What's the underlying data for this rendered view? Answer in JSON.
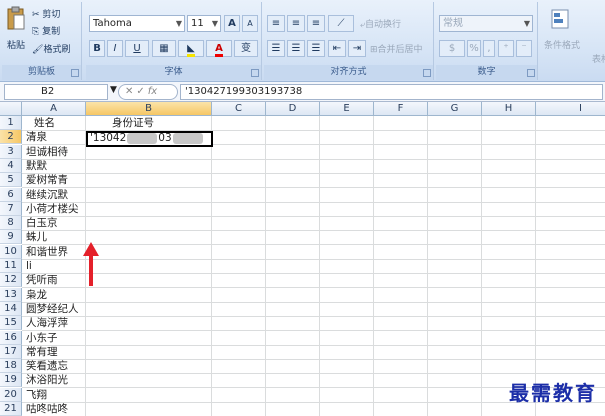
{
  "ribbon": {
    "clipboard": {
      "paste": "粘贴",
      "cut": "剪切",
      "copy": "复制",
      "format_painter": "格式刷",
      "label": "剪贴板"
    },
    "font": {
      "font_name": "Tahoma",
      "font_size": "11",
      "grow": "A",
      "shrink": "A",
      "bold": "B",
      "italic": "I",
      "underline": "U",
      "font_color": "A",
      "phonetic": "变",
      "label": "字体"
    },
    "alignment": {
      "wrap_text": "自动换行",
      "merge_center": "合并后居中",
      "label": "对齐方式"
    },
    "number": {
      "format": "常规",
      "percent": "%",
      "comma": ",",
      "label": "数字"
    },
    "styles": {
      "conditional": "条件格式",
      "table": "表格"
    }
  },
  "formula_bar": {
    "name_box": "B2",
    "fx": "fx",
    "content": "'130427199303193738"
  },
  "columns": [
    "A",
    "B",
    "C",
    "D",
    "E",
    "F",
    "G",
    "H",
    "I"
  ],
  "rows": [
    "1",
    "2",
    "3",
    "4",
    "5",
    "6",
    "7",
    "8",
    "9",
    "10",
    "11",
    "12",
    "13",
    "14",
    "15",
    "16",
    "17",
    "18",
    "19",
    "20",
    "21"
  ],
  "selected_cell": {
    "column": "B",
    "row": "2"
  },
  "header_row": {
    "a": "姓名",
    "b": "身份证号"
  },
  "active_cell_text": {
    "prefix": "'13042",
    "middle": "03"
  },
  "names": [
    "清泉",
    "坦诚相待",
    "默默",
    "爱树常青",
    "继续沉默",
    "小荷才楼尖",
    "白玉京",
    "蛛儿",
    "和谐世界",
    "li",
    "凭听雨",
    "枭龙",
    "圆梦经纪人",
    "人海浮萍",
    "小东子",
    "常有理",
    "笑看遗忘",
    "沐浴阳光",
    "飞翔",
    "咕咚咕咚"
  ],
  "watermark": "最需教育"
}
